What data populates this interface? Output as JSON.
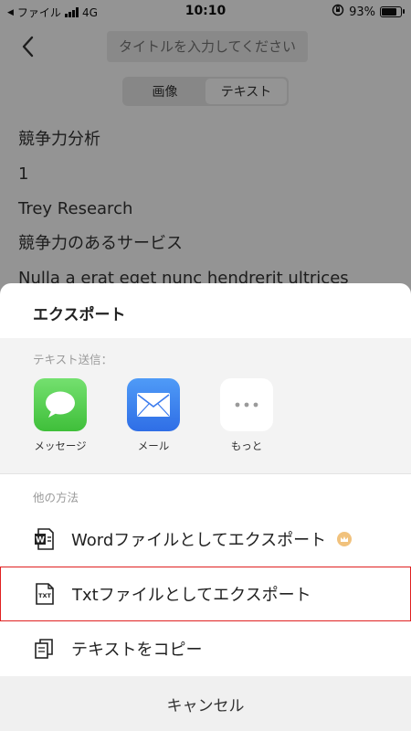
{
  "status_bar": {
    "carrier": "ファイル",
    "network": "4G",
    "time": "10:10",
    "battery": "93%",
    "battery_level": 0.93
  },
  "page": {
    "title_placeholder": "タイトルを入力してください",
    "tabs": [
      {
        "label": "画像",
        "active": false
      },
      {
        "label": "テキスト",
        "active": true
      }
    ],
    "content_lines": [
      "競争力分析",
      "1",
      "Trey Research",
      "競争力のあるサービス",
      "Nulla a erat eget nunc hendrerit ultrices"
    ]
  },
  "sheet": {
    "title": "エクスポート",
    "share_label": "テキスト送信：",
    "apps": [
      {
        "label": "メッセージ",
        "icon": "messages-icon",
        "color": "#5fd35f"
      },
      {
        "label": "メール",
        "icon": "mail-icon",
        "color": "#3b82f6"
      },
      {
        "label": "もっと",
        "icon": "more-icon",
        "color": "#ffffff"
      }
    ],
    "other_label": "他の方法",
    "options": [
      {
        "label": "Wordファイルとしてエクスポート",
        "icon": "word-file-icon",
        "premium": true
      },
      {
        "label": "Txtファイルとしてエクスポート",
        "icon": "txt-file-icon",
        "highlighted": true
      },
      {
        "label": "テキストをコピー",
        "icon": "copy-icon"
      }
    ],
    "cancel": "キャンセル"
  },
  "colors": {
    "highlight_border": "#e02020",
    "premium_badge": "#f1c27d"
  }
}
